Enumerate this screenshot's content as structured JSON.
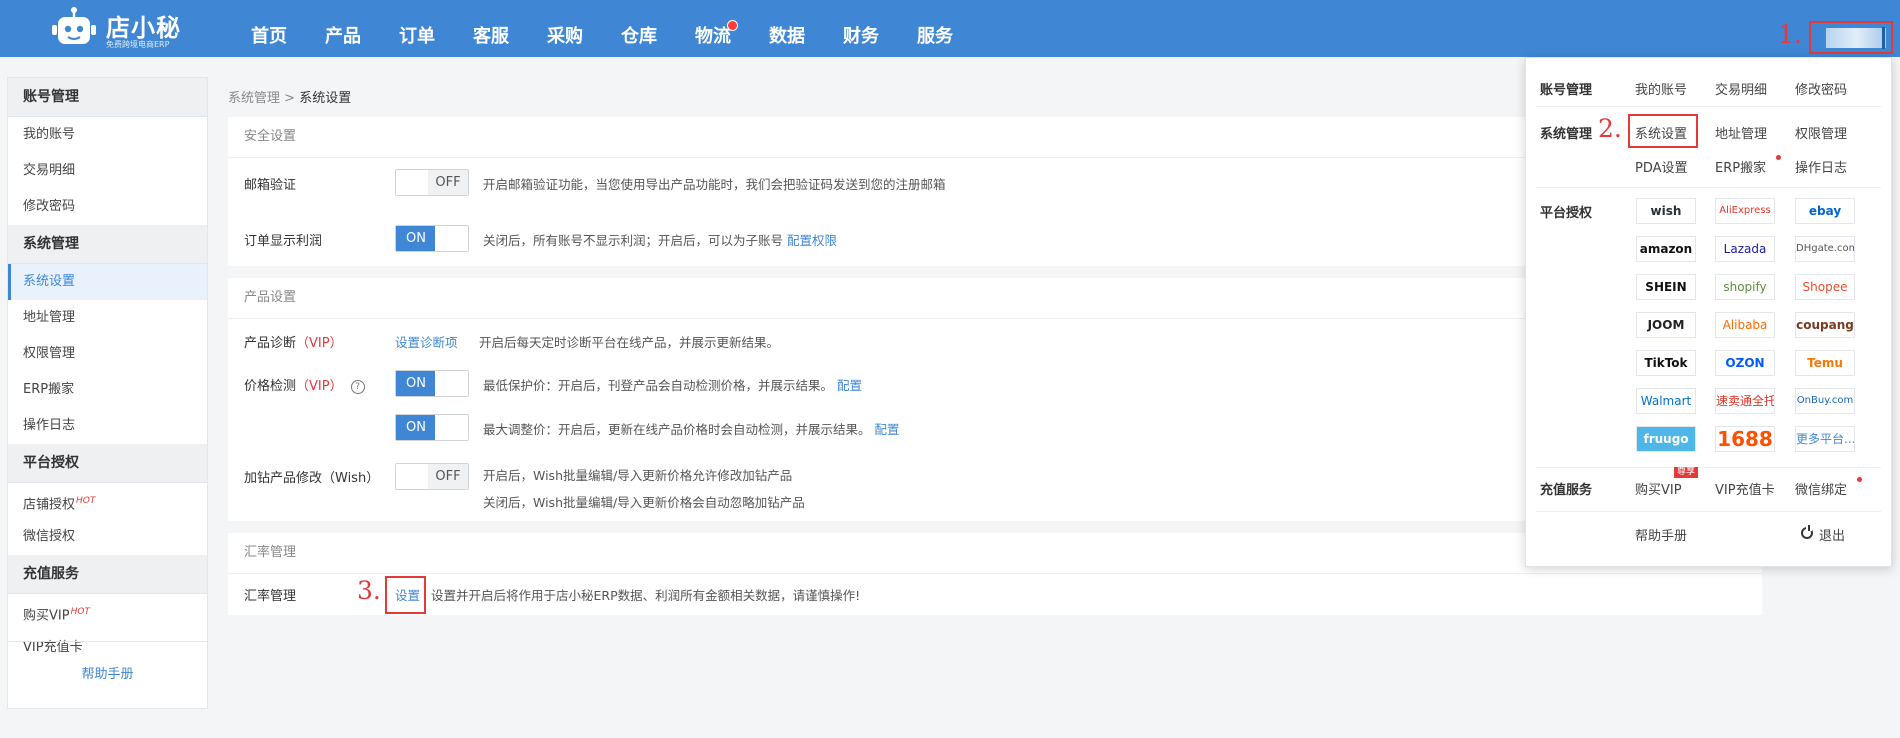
{
  "brand": {
    "name": "店小秘",
    "tagline": "免费跨境电商ERP"
  },
  "nav": [
    "首页",
    "产品",
    "订单",
    "客服",
    "采购",
    "仓库",
    "物流",
    "数据",
    "财务",
    "服务"
  ],
  "steps": [
    "1.",
    "2.",
    "3."
  ],
  "sidebar": {
    "sections": [
      {
        "title": "账号管理",
        "items": [
          "我的账号",
          "交易明细",
          "修改密码"
        ]
      },
      {
        "title": "系统管理",
        "items": [
          "系统设置",
          "地址管理",
          "权限管理",
          "ERP搬家",
          "操作日志"
        ]
      },
      {
        "title": "平台授权",
        "items": [
          "店铺授权",
          "微信授权"
        ]
      },
      {
        "title": "充值服务",
        "items": [
          "购买VIP",
          "VIP充值卡"
        ]
      }
    ],
    "hot": "HOT",
    "help": "帮助手册"
  },
  "breadcrumb": {
    "parent": "系统管理",
    "sep": ">",
    "current": "系统设置"
  },
  "security": {
    "title": "安全设置",
    "email_label": "邮箱验证",
    "email_toggle": "OFF",
    "email_desc": "开启邮箱验证功能，当您使用导出产品功能时，我们会把验证码发送到您的注册邮箱",
    "profit_label": "订单显示利润",
    "profit_toggle": "ON",
    "profit_desc": "关闭后，所有账号不显示利润；开启后，可以为子账号",
    "profit_link": "配置权限"
  },
  "product": {
    "title": "产品设置",
    "diag_label": "产品诊断",
    "vip": "（VIP）",
    "diag_link": "设置诊断项",
    "diag_desc": "开启后每天定时诊断平台在线产品，并展示更新结果。",
    "price_label": "价格检测",
    "help_glyph": "?",
    "price_toggle1": "ON",
    "price_desc1": "最低保护价：开启后，刊登产品会自动检测价格，并展示结果。",
    "price_toggle2": "ON",
    "price_desc2": "最大调整价：开启后，更新在线产品价格时会自动检测，并展示结果。",
    "config_link": "配置",
    "wish_label": "加钻产品修改（Wish）",
    "wish_toggle": "OFF",
    "wish_desc1": "开启后，Wish批量编辑/导入更新价格允许修改加钻产品",
    "wish_desc2": "关闭后，Wish批量编辑/导入更新价格会自动忽略加钻产品"
  },
  "rate": {
    "title": "汇率管理",
    "label": "汇率管理",
    "link": "设置",
    "desc": "设置并开启后将作用于店小秘ERP数据、利润所有金额相关数据，请谨慎操作!"
  },
  "dropdown": {
    "account": {
      "title": "账号管理",
      "items": [
        "我的账号",
        "交易明细",
        "修改密码"
      ]
    },
    "system": {
      "title": "系统管理",
      "items": [
        "系统设置",
        "地址管理",
        "权限管理",
        "PDA设置",
        "ERP搬家",
        "操作日志"
      ]
    },
    "platform_title": "平台授权",
    "platforms": [
      {
        "name": "wish",
        "color": "#2a2f33"
      },
      {
        "name": "AliExpress",
        "color": "#e43225"
      },
      {
        "name": "ebay",
        "color": "#0064d2"
      },
      {
        "name": "amazon",
        "color": "#111111"
      },
      {
        "name": "Lazada",
        "color": "#1a1aa8"
      },
      {
        "name": "DHgate.com",
        "color": "#555555"
      },
      {
        "name": "SHEIN",
        "color": "#111111"
      },
      {
        "name": "shopify",
        "color": "#5e8e3e"
      },
      {
        "name": "Shopee",
        "color": "#ee4d2d"
      },
      {
        "name": "JOOM",
        "color": "#222222"
      },
      {
        "name": "Alibaba",
        "color": "#ff6a00"
      },
      {
        "name": "coupang",
        "color": "#7a3b1f"
      },
      {
        "name": "TikTok",
        "color": "#111111"
      },
      {
        "name": "OZON",
        "color": "#005bff"
      },
      {
        "name": "Temu",
        "color": "#fb7701"
      },
      {
        "name": "Walmart",
        "color": "#0071ce"
      },
      {
        "name": "速卖通全托管",
        "color": "#e43225"
      },
      {
        "name": "OnBuy.com",
        "color": "#1565c0"
      },
      {
        "name": "fruugo",
        "color": "#ffffff"
      },
      {
        "name": "1688",
        "color": "#ff5000"
      },
      {
        "name": "更多平台...",
        "color": "#3f87d4"
      }
    ],
    "recharge": {
      "title": "充值服务",
      "items": [
        "购买VIP",
        "VIP充值卡",
        "微信绑定"
      ],
      "badge": "尊享"
    },
    "help": "帮助手册",
    "logout": "退出"
  }
}
